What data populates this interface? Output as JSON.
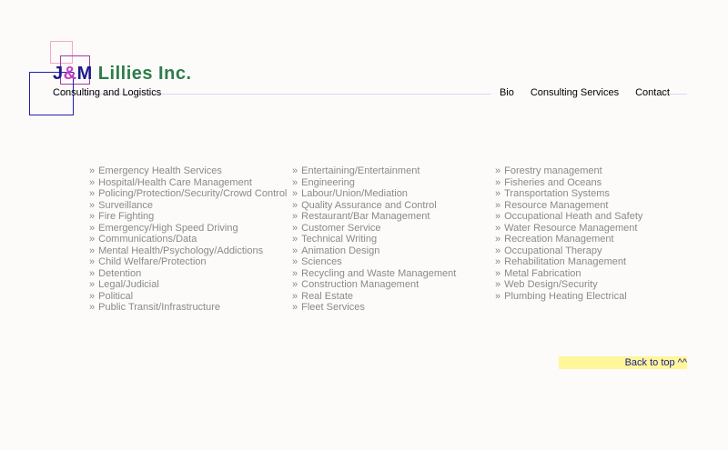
{
  "header": {
    "logo": {
      "j": "J",
      "amp": "&",
      "m": "M",
      "rest": " Lillies Inc."
    },
    "tagline": "Consulting and Logistics"
  },
  "nav": {
    "items": [
      "Bio",
      "Consulting Services",
      "Contact"
    ]
  },
  "services": {
    "bullet": "»",
    "column1": [
      "Emergency Health Services",
      "Hospital/Health Care Management",
      "Policing/Protection/Security/Crowd Control",
      "Surveillance",
      "Fire Fighting",
      "Emergency/High Speed Driving",
      "Communications/Data",
      "Mental Health/Psychology/Addictions",
      "Child Welfare/Protection",
      "Detention",
      "Legal/Judicial",
      "Political",
      "Public Transit/Infrastructure"
    ],
    "column2": [
      "Entertaining/Entertainment",
      "Engineering",
      "Labour/Union/Mediation",
      "Quality Assurance and Control",
      "Restaurant/Bar Management",
      "Customer Service",
      "Technical Writing",
      "Animation Design",
      "Sciences",
      "Recycling and Waste Management",
      "Construction Management",
      "Real Estate",
      "Fleet Services"
    ],
    "column3": [
      "Forestry management",
      "Fisheries and Oceans",
      "Transportation Systems",
      "Resource Management",
      "Occupational Heath and Safety",
      "Water Resource Management",
      "Recreation Management",
      "Occupational Therapy",
      "Rehabilitation Management",
      "Metal Fabrication",
      "Web Design/Security",
      "Plumbing Heating Electrical"
    ]
  },
  "footer": {
    "back_to_top": "Back to top ^^"
  },
  "colors": {
    "background": "#fcfbfa",
    "logo_dark": "#1a1a8c",
    "logo_accent": "#c040c0",
    "logo_green": "#2e7d4a",
    "list_text": "#8a8a8a",
    "back_bar": "#fff799"
  }
}
